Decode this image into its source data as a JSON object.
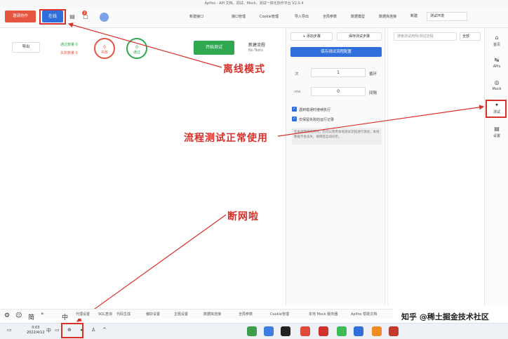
{
  "window": {
    "title": "Apifox - API 文档、调试、Mock、测试一体化协作平台 V2.0.4"
  },
  "toolbar": {
    "invite_label": "邀请协作",
    "online_label": "在线",
    "tab_name": "新建接口",
    "items": [
      "接口管理",
      "Cookie管理",
      "导入导出",
      "全局参数",
      "数据模型",
      "数据库连接"
    ],
    "new_label": "新建",
    "env_value": "测试环境"
  },
  "rail": {
    "items": [
      {
        "icon": "home-icon",
        "label": "首页"
      },
      {
        "icon": "api-icon",
        "label": "APIs"
      },
      {
        "icon": "mock-icon",
        "label": "Mock"
      },
      {
        "icon": "test-icon",
        "label": "测试"
      },
      {
        "icon": "doc-icon",
        "label": "设置"
      }
    ]
  },
  "tree": {
    "search_placeholder": "搜索测试用例/测试流程",
    "filter_value": "全部"
  },
  "config": {
    "btn_save": "保存测试步骤",
    "btn_add": "+ 添加步骤",
    "primary": "保存测试流程配置",
    "loop_label": "循环",
    "loop_value": "1",
    "loop_unit": "次",
    "interval_label": "间隔",
    "interval_value": "0",
    "interval_unit": "ms",
    "check1": "遇到错误时继续执行",
    "check2": "仅保留失败的运行记录",
    "note": "在本地网络断开时，仍可以使用本地测试流程进行测试，本地数据不会丢失，联网后自动同步。"
  },
  "main": {
    "run_label": "开始测试",
    "flow_name": "新建流程",
    "flow_env": "No Tests",
    "pass_count": "0",
    "pass_label": "通过",
    "fail_count": "0",
    "fail_label": "失败",
    "stat_pass": "通过数量 0",
    "stat_fail": "失败数量 0",
    "export_label": "导出"
  },
  "annotations": {
    "offline": "离线模式",
    "flow_ok": "流程测试正常使用",
    "disconnected": "断网啦"
  },
  "status_bar": {
    "items": [
      "Apifox 帮助文档",
      "本地 Mock 服务器",
      "Cookie管理",
      "全局参数",
      "数据库连接",
      "主题设置",
      "偏好设置",
      "代码生成",
      "SQL查询",
      "代理设置"
    ]
  },
  "ime": {
    "items": [
      "中",
      "°",
      "简",
      "☺",
      "⚙"
    ]
  },
  "taskbar": {
    "time": "0:03",
    "date": "2022/4/12",
    "tray_lang": "中"
  },
  "watermark": "知乎 @稀土掘金技术社区"
}
